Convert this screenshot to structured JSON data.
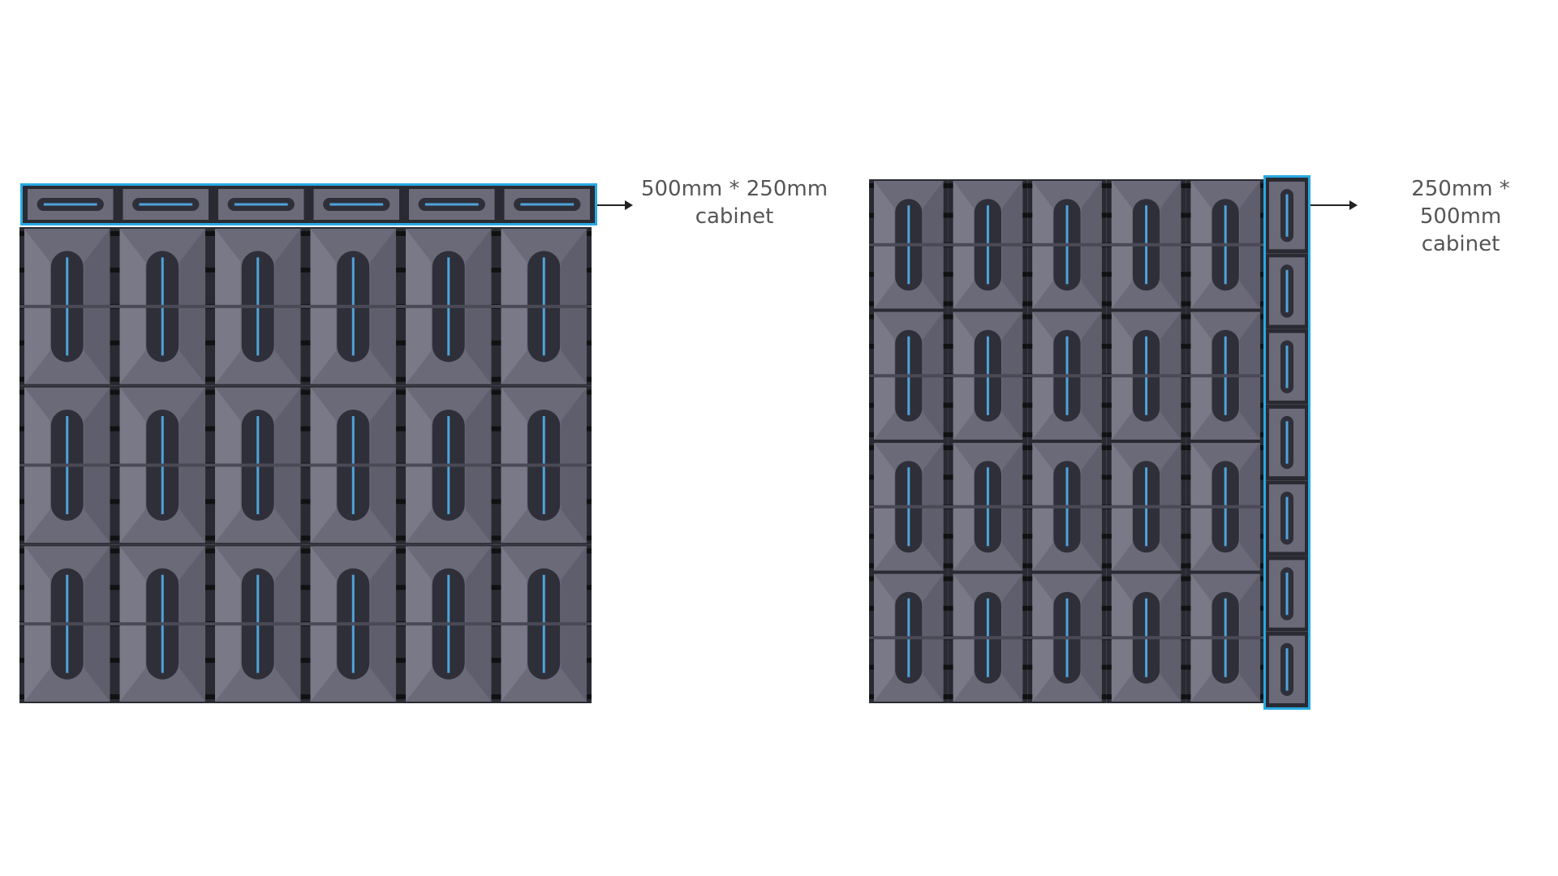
{
  "left_panel": {
    "caption_line1": "500mm * 250mm",
    "caption_line2": "cabinet",
    "cabinet_grid": {
      "columns": 6,
      "rows": 3,
      "highlighted_strip_modules": 6
    }
  },
  "right_panel": {
    "caption_line1": "250mm * 500mm",
    "caption_line2": "cabinet",
    "cabinet_grid": {
      "columns": 5,
      "rows": 4,
      "highlighted_strip_modules": 7
    }
  },
  "colors": {
    "highlight": "#29a9e1",
    "cabinet_face": "#6b6a78",
    "cabinet_dark": "#2a2a33",
    "led_accent": "#4fa3d9",
    "caption_text": "#555555"
  }
}
